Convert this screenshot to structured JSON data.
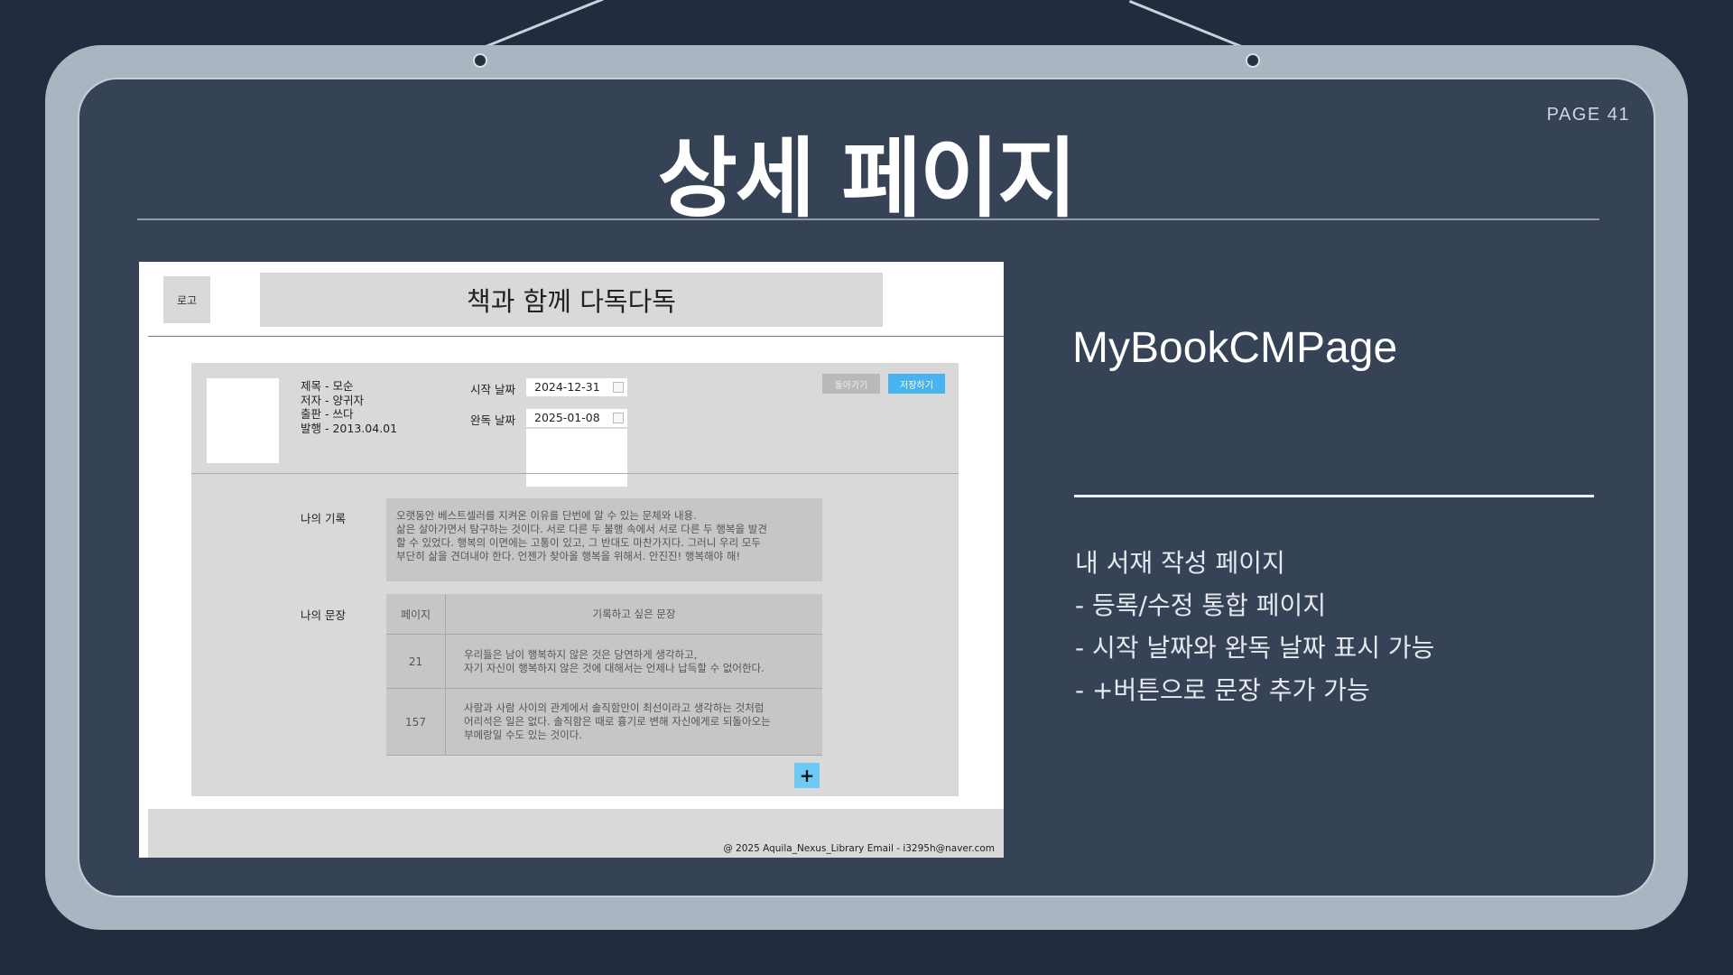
{
  "slide": {
    "page_label": "PAGE 41",
    "title": "상세 페이지",
    "component_name": "MyBookCMPage",
    "description": [
      "내 서재 작성 페이지",
      "- 등록/수정 통합 페이지",
      "- 시작 날짜와 완독 날짜 표시 가능",
      "- +버튼으로 문장 추가 가능"
    ]
  },
  "mockup": {
    "logo": "로고",
    "site_title": "책과 함께 다독다독",
    "book": {
      "title": "제목 - 모순",
      "author": "저자 - 양귀자",
      "publisher": "출판 - 쓰다",
      "published": "발행 - 2013.04.01"
    },
    "start_label": "시작 날짜",
    "start_date": "2024-12-31",
    "end_label": "완독 날짜",
    "end_date": "2025-01-08",
    "back_button": "돌아가기",
    "save_button": "저장하기",
    "record_label": "나의 기록",
    "record_lines": [
      "오랫동안 베스트셀러를 지켜온 이유를 단번에 알 수 있는 문체와 내용.",
      "삶은 살아가면서 탐구하는 것이다. 서로 다른 두 불행 속에서 서로 다른 두 행복을 발견",
      "할 수 있었다. 행복의 이면에는 고통이 있고, 그 반대도 마찬가지다. 그러니 우리 모두",
      "부단히 삶을 견뎌내야 한다. 언젠가 찾아올 행복을 위해서. 안진진! 행복해야 해!"
    ],
    "sentence_label": "나의 문장",
    "table_headers": {
      "page": "페이지",
      "sentence": "기록하고 싶은 문장"
    },
    "sentences": [
      {
        "page": "21",
        "lines": [
          "우리들은 남이 행복하지 않은 것은 당연하게 생각하고,",
          "자기 자신이 행복하지 않은 것에 대해서는 언제나 납득할 수 없어한다."
        ]
      },
      {
        "page": "157",
        "lines": [
          "사람과 사람 사이의 관계에서 솔직함만이 최선이라고 생각하는 것처럼",
          "어리석은 일은 없다. 솔직함은 때로 흉기로 변해 자신에게로 되돌아오는",
          "부메랑일 수도 있는 것이다."
        ]
      }
    ],
    "add_button": "+",
    "footer": "@ 2025 Aquila_Nexus_Library   Email - i3295h@naver.com"
  }
}
